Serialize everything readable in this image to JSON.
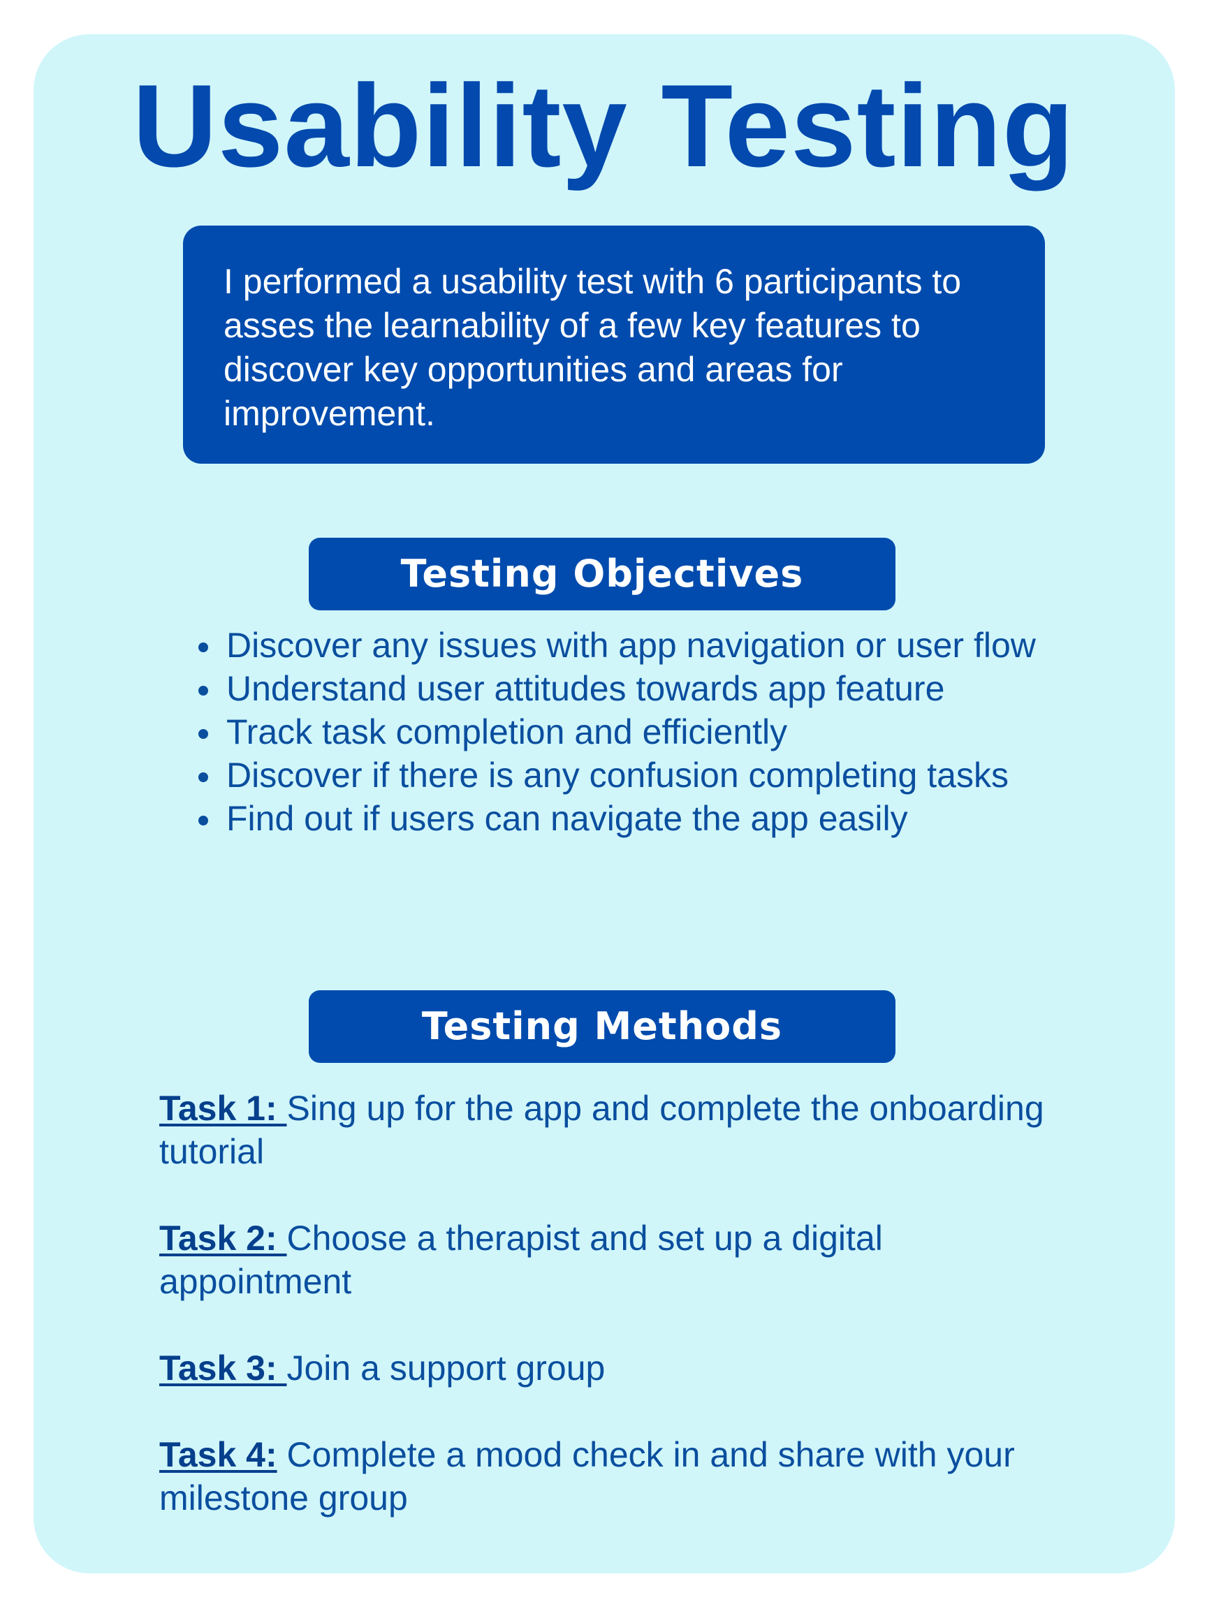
{
  "title": "Usability Testing",
  "intro": "I performed a usability test with 6 participants to asses the learnability of a few key features to discover key opportunities and areas for improvement.",
  "objectives": {
    "header": "Testing Objectives",
    "items": [
      "Discover any issues with app navigation or user flow",
      "Understand user attitudes towards app feature",
      "Track task completion and efficiently",
      "Discover if there is any confusion completing tasks",
      "Find out if users can navigate the app easily"
    ]
  },
  "methods": {
    "header": "Testing Methods",
    "tasks": [
      {
        "label": "Task 1: ",
        "text": "Sing up for the app and complete the onboarding tutorial"
      },
      {
        "label": "Task 2: ",
        "text": "Choose a therapist and set up a digital appointment"
      },
      {
        "label": "Task 3: ",
        "text": "Join a support group"
      },
      {
        "label": "Task 4:",
        "text": " Complete a mood check in and share with your milestone group"
      }
    ]
  },
  "colors": {
    "background_card": "#d0f6fa",
    "accent": "#004bad",
    "title": "#0349ae",
    "body_text": "#0a4e9e"
  }
}
